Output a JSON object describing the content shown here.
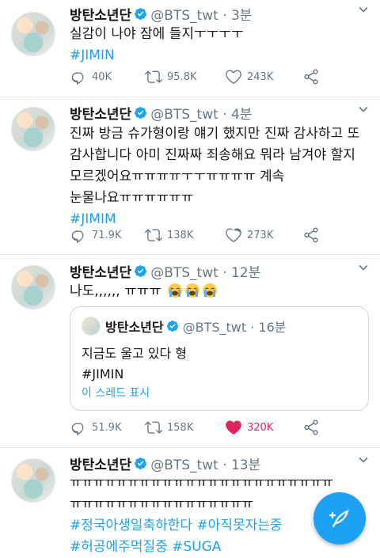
{
  "tweets": [
    {
      "name": "방탄소년단",
      "handle": "@BTS_twt · 3분",
      "lines": [
        "실감이 나야 잠에 들지ㅜㅜㅜㅜ"
      ],
      "hashtags": [
        "#JIMIN"
      ],
      "replies": "40K",
      "retweets": "95.8K",
      "likes": "243K"
    },
    {
      "name": "방탄소년단",
      "handle": "@BTS_twt · 4분",
      "lines": [
        "진짜 방금 슈가형이랑 얘기 했지만 진짜 감사하고 또",
        "감사합니다 아미 진짜짜 죄송해요 뭐라 남겨야 할지",
        "모르겠어요ㅠㅠㅠㅠㅜㅜㅠㅠㅠㅠ 계속",
        "눈물나요ㅠㅠㅠㅠㅠㅠ"
      ],
      "hashtags": [
        "#JIMIM"
      ],
      "replies": "71.9K",
      "retweets": "138K",
      "likes": "273K"
    },
    {
      "name": "방탄소년단",
      "handle": "@BTS_twt · 12분",
      "lines": [
        "나도,,,,,, ㅠㅠㅠ"
      ],
      "emoji": "loudly-crying-face",
      "quote": {
        "name": "방탄소년단",
        "handle": "@BTS_twt · 16분",
        "text": "지금도 울고 있다 형",
        "hashtag": "#JIMIN",
        "thread_link": "이 스레드 표시"
      },
      "replies": "51.9K",
      "retweets": "158K",
      "likes": "320K",
      "liked": true
    },
    {
      "name": "방탄소년단",
      "handle": "@BTS_twt · 13분",
      "lines": [
        "ㅠㅠㅠㅠㅠㅠㅠㅠㅠㅠㅠㅠㅠㅠㅠㅠㅠㅠㅠㅠㅠㅠㅠ",
        "ㅠㅠㅠㅠㅠㅠㅠㅠㅠㅠㅠㅠㅠㅠㅠㅠ"
      ],
      "hashtags": [
        "#정국아생일축하한다",
        "#아직못자는중",
        "#허공에주먹질중",
        "#SUGA"
      ]
    }
  ],
  "colors": {
    "accent": "#1da1f2",
    "muted": "#657786",
    "like": "#e0245e",
    "divider": "#e1e8ed"
  },
  "fab": {
    "icon": "compose-tweet-icon"
  }
}
